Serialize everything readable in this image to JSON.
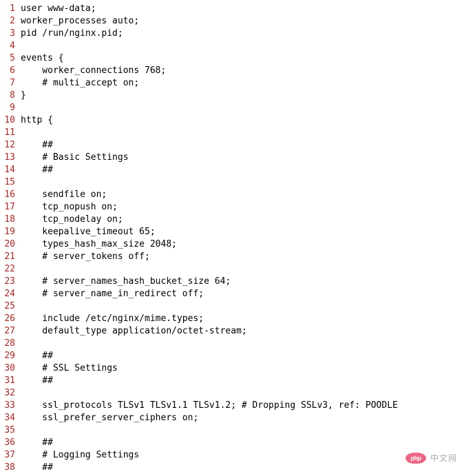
{
  "lines": [
    {
      "n": "1",
      "t": "user www-data;"
    },
    {
      "n": "2",
      "t": "worker_processes auto;"
    },
    {
      "n": "3",
      "t": "pid /run/nginx.pid;"
    },
    {
      "n": "4",
      "t": ""
    },
    {
      "n": "5",
      "t": "events {"
    },
    {
      "n": "6",
      "t": "    worker_connections 768;"
    },
    {
      "n": "7",
      "t": "    # multi_accept on;"
    },
    {
      "n": "8",
      "t": "}"
    },
    {
      "n": "9",
      "t": ""
    },
    {
      "n": "10",
      "t": "http {"
    },
    {
      "n": "11",
      "t": ""
    },
    {
      "n": "12",
      "t": "    ##"
    },
    {
      "n": "13",
      "t": "    # Basic Settings"
    },
    {
      "n": "14",
      "t": "    ##"
    },
    {
      "n": "15",
      "t": ""
    },
    {
      "n": "16",
      "t": "    sendfile on;"
    },
    {
      "n": "17",
      "t": "    tcp_nopush on;"
    },
    {
      "n": "18",
      "t": "    tcp_nodelay on;"
    },
    {
      "n": "19",
      "t": "    keepalive_timeout 65;"
    },
    {
      "n": "20",
      "t": "    types_hash_max_size 2048;"
    },
    {
      "n": "21",
      "t": "    # server_tokens off;"
    },
    {
      "n": "22",
      "t": ""
    },
    {
      "n": "23",
      "t": "    # server_names_hash_bucket_size 64;"
    },
    {
      "n": "24",
      "t": "    # server_name_in_redirect off;"
    },
    {
      "n": "25",
      "t": ""
    },
    {
      "n": "26",
      "t": "    include /etc/nginx/mime.types;"
    },
    {
      "n": "27",
      "t": "    default_type application/octet-stream;"
    },
    {
      "n": "28",
      "t": ""
    },
    {
      "n": "29",
      "t": "    ##"
    },
    {
      "n": "30",
      "t": "    # SSL Settings"
    },
    {
      "n": "31",
      "t": "    ##"
    },
    {
      "n": "32",
      "t": ""
    },
    {
      "n": "33",
      "t": "    ssl_protocols TLSv1 TLSv1.1 TLSv1.2; # Dropping SSLv3, ref: POODLE"
    },
    {
      "n": "34",
      "t": "    ssl_prefer_server_ciphers on;"
    },
    {
      "n": "35",
      "t": ""
    },
    {
      "n": "36",
      "t": "    ##"
    },
    {
      "n": "37",
      "t": "    # Logging Settings"
    },
    {
      "n": "38",
      "t": "    ##"
    }
  ],
  "watermark": {
    "logo_text": "php",
    "site_text": "中文网"
  }
}
